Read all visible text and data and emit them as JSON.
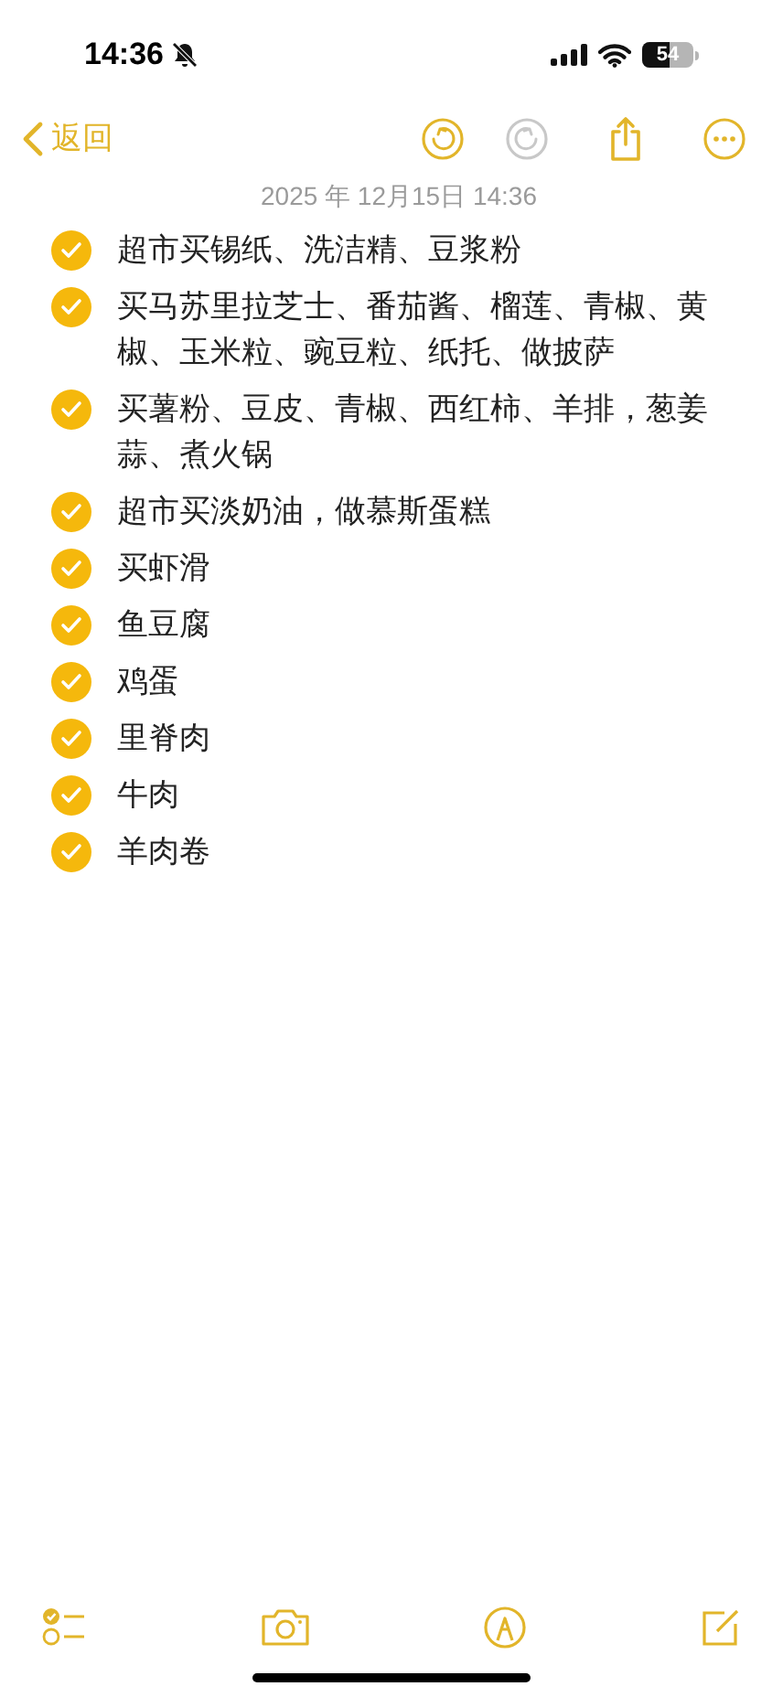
{
  "status_bar": {
    "time": "14:36",
    "battery": "54"
  },
  "nav": {
    "back": "返回",
    "undo": {
      "disabled": false
    },
    "redo": {
      "disabled": true
    }
  },
  "note": {
    "date": "2025 年 12月15日 14:36",
    "items": [
      {
        "text": "超市买锡纸、洗洁精、豆浆粉",
        "checked": true
      },
      {
        "text": "买马苏里拉芝士、番茄酱、榴莲、青椒、黄椒、玉米粒、豌豆粒、纸托、做披萨",
        "checked": true
      },
      {
        "text": "买薯粉、豆皮、青椒、西红柿、羊排，葱姜蒜、煮火锅",
        "checked": true
      },
      {
        "text": "超市买淡奶油，做慕斯蛋糕",
        "checked": true
      },
      {
        "text": "买虾滑",
        "checked": true
      },
      {
        "text": "鱼豆腐",
        "checked": true
      },
      {
        "text": "鸡蛋",
        "checked": true
      },
      {
        "text": "里脊肉",
        "checked": true
      },
      {
        "text": "牛肉",
        "checked": true
      },
      {
        "text": "羊肉卷",
        "checked": true
      }
    ]
  }
}
